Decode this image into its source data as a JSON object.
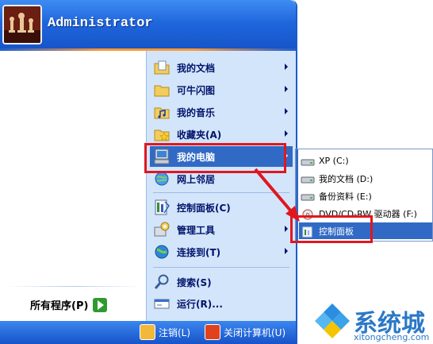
{
  "header": {
    "username": "Administrator"
  },
  "left": {
    "all_programs": "所有程序(P)"
  },
  "right": {
    "items": [
      {
        "label": "我的文档",
        "icon": "documents-folder-icon",
        "arrow": true
      },
      {
        "label": "可牛闪图",
        "icon": "folder-icon",
        "arrow": true
      },
      {
        "label": "我的音乐",
        "icon": "music-folder-icon",
        "arrow": true
      },
      {
        "label": "收藏夹(A)",
        "icon": "favorites-folder-icon",
        "arrow": true
      },
      {
        "label": "我的电脑",
        "icon": "my-computer-icon",
        "arrow": true,
        "selected": true
      },
      {
        "label": "网上邻居",
        "icon": "network-icon",
        "arrow": false
      },
      {
        "label": "控制面板(C)",
        "icon": "control-panel-icon",
        "arrow": false
      },
      {
        "label": "管理工具",
        "icon": "admin-tools-icon",
        "arrow": true
      },
      {
        "label": "连接到(T)",
        "icon": "connect-to-icon",
        "arrow": true
      },
      {
        "label": "搜索(S)",
        "icon": "search-icon",
        "arrow": false
      },
      {
        "label": "运行(R)...",
        "icon": "run-icon",
        "arrow": false
      }
    ]
  },
  "footer": {
    "logoff": "注销(L)",
    "shutdown": "关闭计算机(U)"
  },
  "submenu": {
    "items": [
      {
        "label": "XP (C:)",
        "icon": "drive-icon"
      },
      {
        "label": "我的文档 (D:)",
        "icon": "drive-icon"
      },
      {
        "label": "备份资料 (E:)",
        "icon": "drive-icon"
      },
      {
        "label": "DVD/CD-RW 驱动器 (F:)",
        "icon": "dvd-drive-icon"
      },
      {
        "label": "控制面板",
        "icon": "control-panel-icon",
        "selected": true
      }
    ]
  },
  "watermark": {
    "text": "系统城",
    "url": "xitongcheng.com"
  },
  "colors": {
    "highlight": "#316ac5",
    "annotation_red": "#e0171f",
    "header_blue": "#1f66dd"
  }
}
